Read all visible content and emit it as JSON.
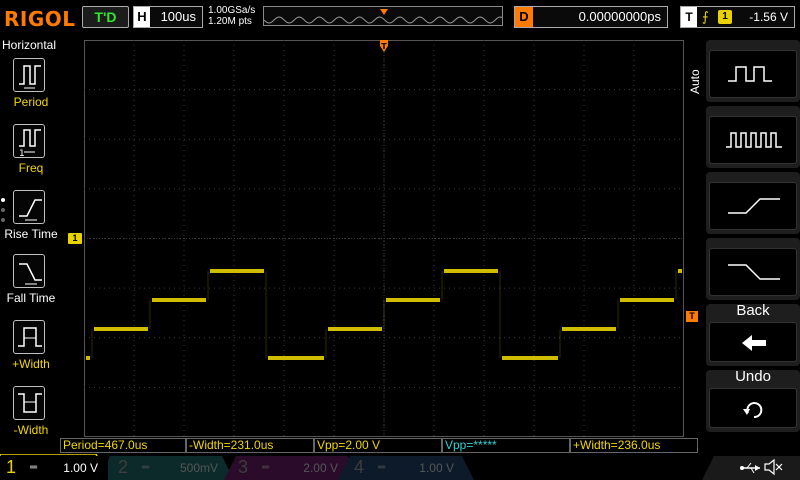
{
  "brand": "RIGOL",
  "run_state": "T'D",
  "timebase": {
    "tag": "H",
    "value": "100us"
  },
  "sample": {
    "rate": "1.00GSa/s",
    "points": "1.20M pts"
  },
  "delay": {
    "tag": "D",
    "value": "0.00000000ps"
  },
  "trigger": {
    "tag": "T",
    "source": "1",
    "level": "-1.56 V"
  },
  "left_panel": {
    "title": "Horizontal",
    "items": [
      {
        "label": "Period",
        "icon": "period-icon"
      },
      {
        "label": "Freq",
        "icon": "frequency-icon"
      },
      {
        "label": "Rise Time",
        "icon": "rise-time-icon"
      },
      {
        "label": "Fall Time",
        "icon": "fall-time-icon"
      },
      {
        "label": "+Width",
        "icon": "positive-width-icon"
      },
      {
        "label": "-Width",
        "icon": "negative-width-icon"
      }
    ]
  },
  "right_panel": {
    "mode_label": "Auto",
    "back_label": "Back",
    "undo_label": "Undo"
  },
  "channel1_marker": "1",
  "trigger_marker": "T",
  "measurements": [
    {
      "text": "Period=467.0us",
      "color": "yellow"
    },
    {
      "text": "-Width=231.0us",
      "color": "yellow"
    },
    {
      "text": "Vpp=2.00 V",
      "color": "yellow"
    },
    {
      "text": "Vpp=*****",
      "color": "cyan"
    },
    {
      "text": "+Width=236.0us",
      "color": "yellow"
    }
  ],
  "channels": [
    {
      "num": "1",
      "scale": "1.00 V",
      "color": "#e8d200",
      "active": true
    },
    {
      "num": "2",
      "scale": "500mV",
      "color": "#2fd3d9",
      "active": false
    },
    {
      "num": "3",
      "scale": "2.00 V",
      "color": "#d23cd2",
      "active": false
    },
    {
      "num": "4",
      "scale": "1.00 V",
      "color": "#2f6fd9",
      "active": false
    }
  ],
  "colors": {
    "ch1": "#e8d200",
    "accent_orange": "#ff7a00",
    "grid": "#3a3a3a"
  }
}
